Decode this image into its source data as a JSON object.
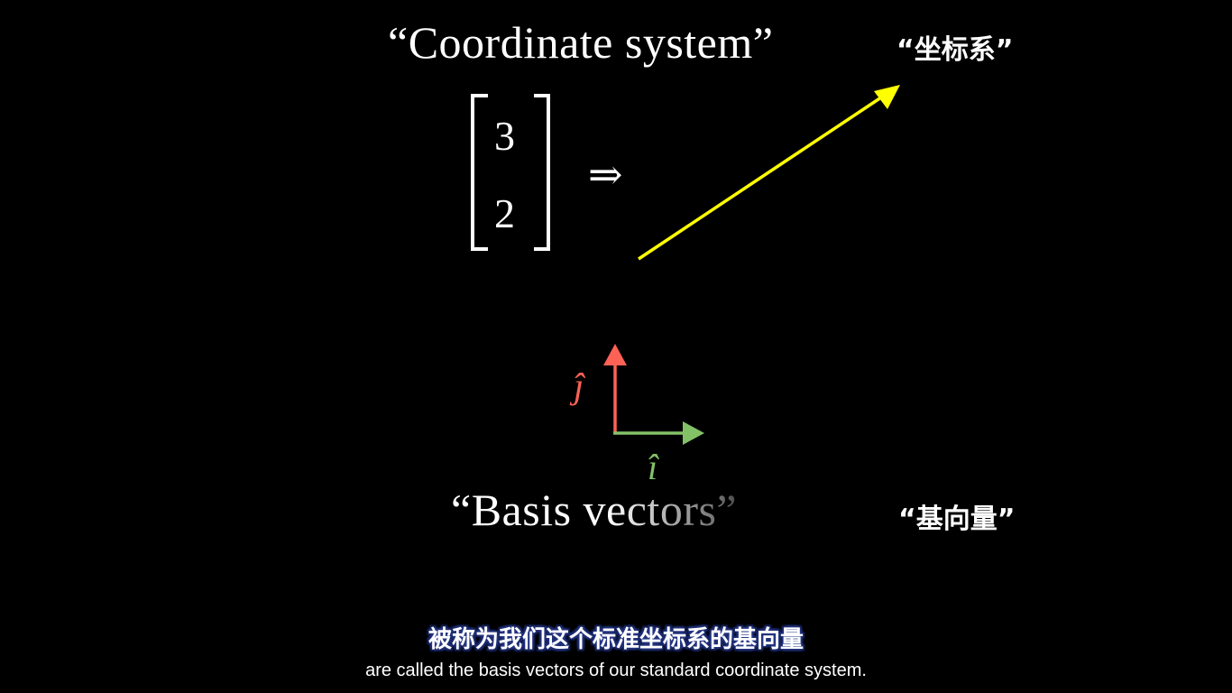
{
  "top": {
    "title": "“Coordinate system”",
    "title_cn": "“坐标系”"
  },
  "matrix": {
    "top_value": "3",
    "bottom_value": "2",
    "implies_symbol": "⇒"
  },
  "vector": {
    "color": "#ffff00"
  },
  "basis": {
    "j_hat_label": "ĵ",
    "i_hat_label": "î",
    "j_color": "#fc6255",
    "i_color": "#83c167",
    "title": "“Basis vectors”",
    "title_cn": "“基向量”"
  },
  "subtitles": {
    "cn": "被称为我们这个标准坐标系的基向量",
    "en": "are called the basis vectors of our standard coordinate system."
  }
}
